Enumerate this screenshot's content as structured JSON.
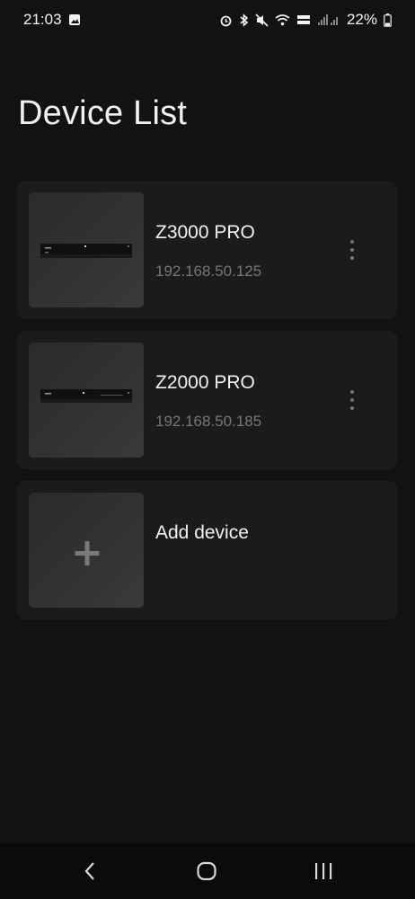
{
  "status_bar": {
    "time": "21:03",
    "battery": "22%",
    "icons": [
      "image-icon",
      "alarm-icon",
      "bluetooth-icon",
      "mute-icon",
      "wifi-icon",
      "volte-icon",
      "signal-icon",
      "battery-icon"
    ]
  },
  "page": {
    "title": "Device List"
  },
  "devices": [
    {
      "name": "Z3000 PRO",
      "ip": "192.168.50.125"
    },
    {
      "name": "Z2000 PRO",
      "ip": "192.168.50.185"
    }
  ],
  "add_device": {
    "label": "Add device",
    "icon": "plus-icon"
  },
  "nav": {
    "icons": [
      "back-icon",
      "home-icon",
      "recents-icon"
    ]
  },
  "colors": {
    "background": "#121212",
    "card": "#1b1b1b",
    "secondary_text": "#777777"
  }
}
